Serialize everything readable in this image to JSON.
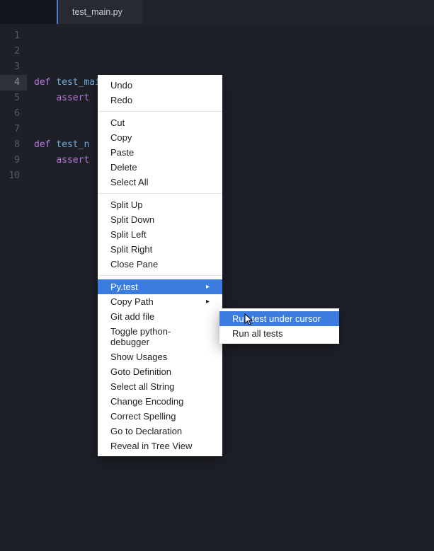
{
  "tab": {
    "title": "test_main.py"
  },
  "line_numbers": [
    "1",
    "2",
    "3",
    "4",
    "5",
    "6",
    "7",
    "8",
    "9",
    "10"
  ],
  "active_line_index": 3,
  "code_lines": [
    {
      "text": ""
    },
    {
      "text": ""
    },
    {
      "text": ""
    },
    {
      "kw": "def ",
      "fn": "test_main",
      "rest": "():"
    },
    {
      "indent": "    ",
      "kw": "assert",
      "rest": ""
    },
    {
      "text": ""
    },
    {
      "text": ""
    },
    {
      "kw": "def ",
      "fn": "test_n",
      "rest": ""
    },
    {
      "indent": "    ",
      "kw": "assert",
      "rest": ""
    },
    {
      "text": ""
    }
  ],
  "context_menu": {
    "groups": [
      [
        "Undo",
        "Redo"
      ],
      [
        "Cut",
        "Copy",
        "Paste",
        "Delete",
        "Select All"
      ],
      [
        "Split Up",
        "Split Down",
        "Split Left",
        "Split Right",
        "Close Pane"
      ],
      [
        {
          "label": "Py.test",
          "submenu": true,
          "highlight": true
        },
        {
          "label": "Copy Path",
          "submenu": true
        },
        "Git add file",
        "Toggle python-debugger",
        "Show Usages",
        "Goto Definition",
        "Select all String",
        "Change Encoding",
        "Correct Spelling",
        "Go to Declaration",
        "Reveal in Tree View"
      ]
    ]
  },
  "submenu": {
    "items": [
      {
        "label": "Run test under cursor",
        "highlight": true
      },
      {
        "label": "Run all tests"
      }
    ]
  }
}
